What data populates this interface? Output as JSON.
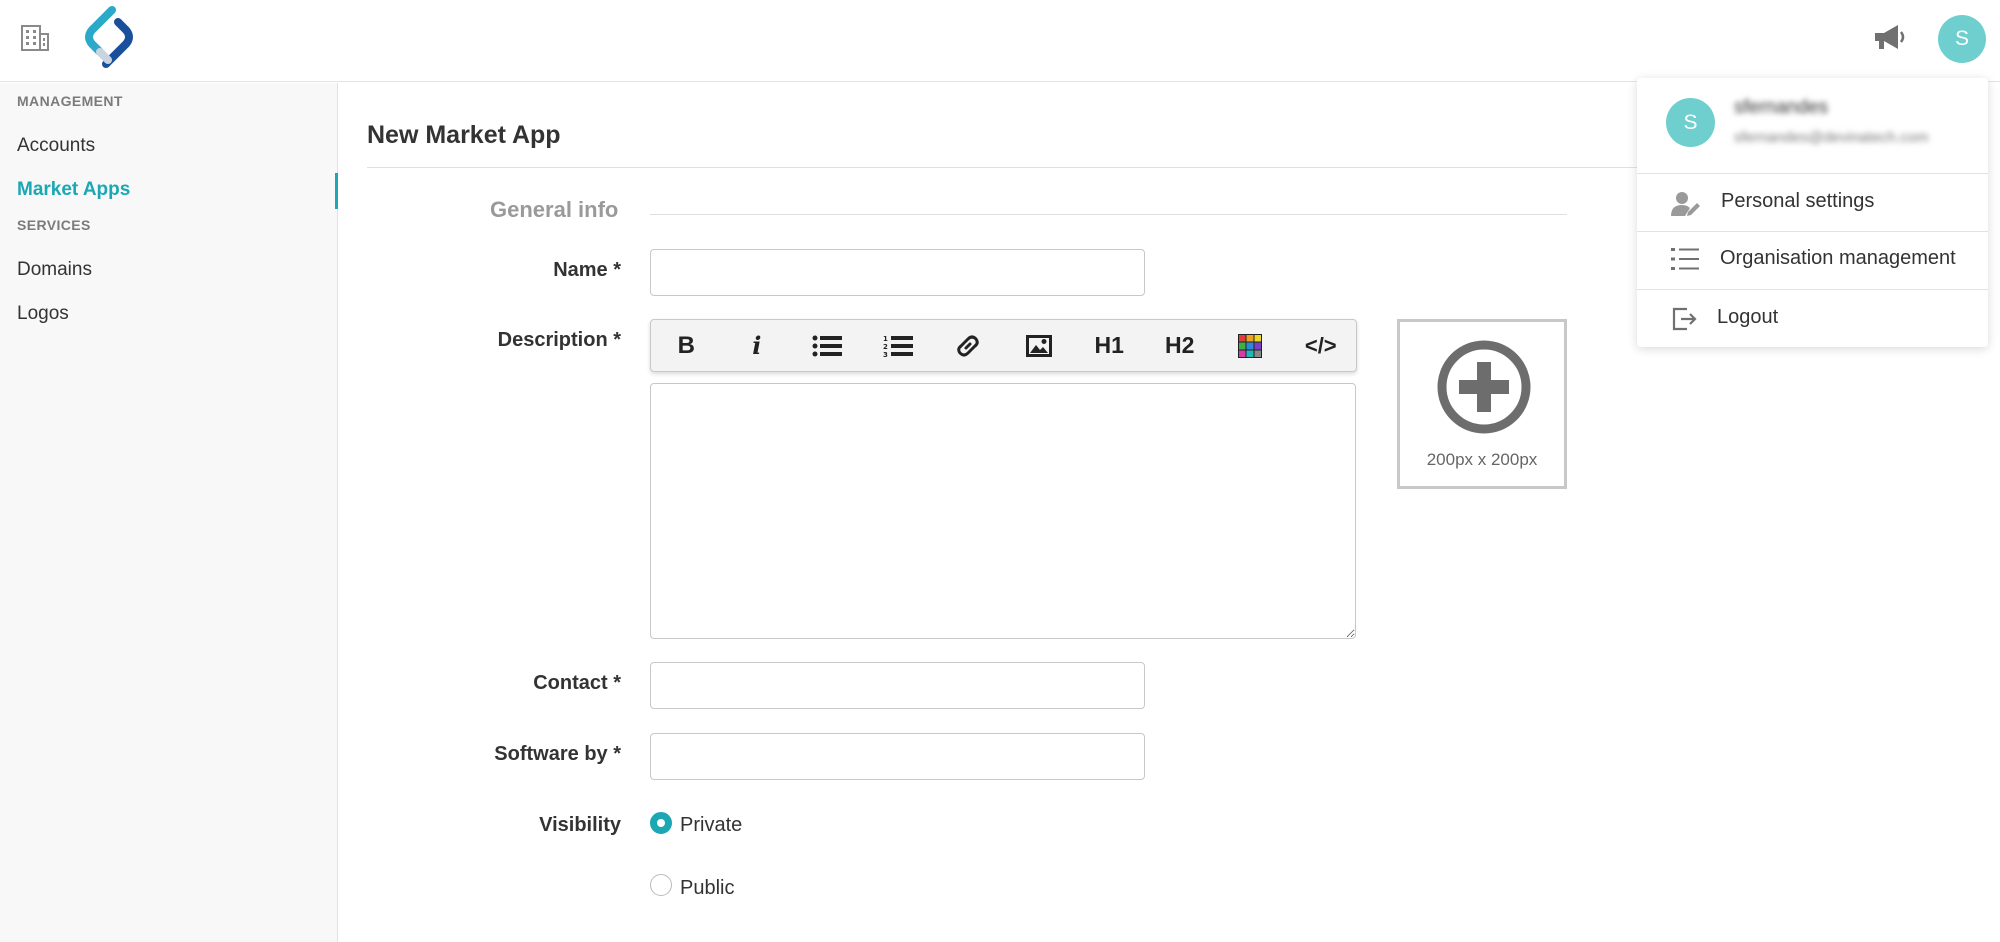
{
  "header": {
    "avatar_initial": "S"
  },
  "sidebar": {
    "sections": [
      {
        "heading": "MANAGEMENT",
        "items": [
          {
            "label": "Accounts"
          },
          {
            "label": "Market Apps",
            "active": true
          }
        ]
      },
      {
        "heading": "SERVICES",
        "items": [
          {
            "label": "Domains"
          },
          {
            "label": "Logos"
          }
        ]
      }
    ]
  },
  "main": {
    "title": "New Market App",
    "section": "General info",
    "fields": {
      "name_label": "Name *",
      "name_value": "",
      "description_label": "Description *",
      "contact_label": "Contact *",
      "contact_value": "",
      "software_label": "Software by *",
      "software_value": "",
      "visibility_label": "Visibility"
    },
    "toolbar": {
      "bold": "B",
      "italic": "i",
      "h1": "H1",
      "h2": "H2",
      "code": "</>"
    },
    "image_upload": {
      "size_text": "200px x 200px"
    },
    "visibility_options": [
      {
        "label": "Private",
        "checked": true
      },
      {
        "label": "Public",
        "checked": false
      }
    ]
  },
  "user_menu": {
    "avatar_initial": "S",
    "username": "sfernandes",
    "email": "sfernandes@devinatech.com",
    "items": [
      {
        "label": "Personal settings",
        "icon": "user-edit-icon"
      },
      {
        "label": "Organisation management",
        "icon": "list-icon"
      },
      {
        "label": "Logout",
        "icon": "logout-icon"
      }
    ]
  },
  "colors": {
    "accent": "#1ba7b3",
    "avatar": "#6fcfcf"
  }
}
